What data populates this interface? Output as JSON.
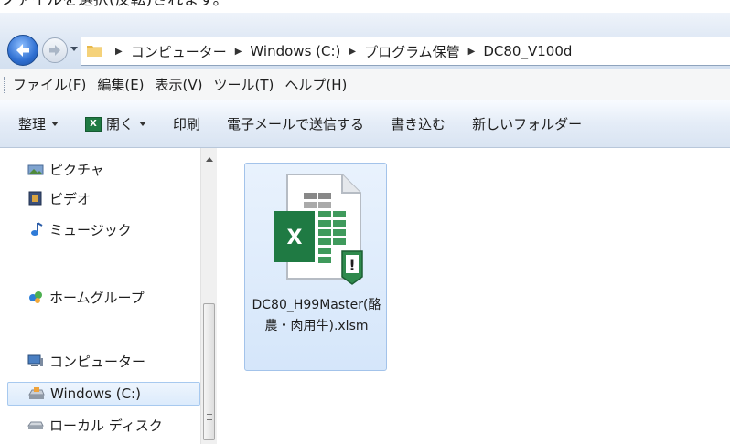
{
  "caption": "ファイルを選択(反転)されます。",
  "address": {
    "crumbs": [
      "コンピューター",
      "Windows (C:)",
      "プログラム保管",
      "DC80_V100d"
    ]
  },
  "menu": {
    "items": [
      "ファイル(F)",
      "編集(E)",
      "表示(V)",
      "ツール(T)",
      "ヘルプ(H)"
    ]
  },
  "commands": {
    "organize": "整理",
    "open": "開く",
    "print": "印刷",
    "email": "電子メールで送信する",
    "burn": "書き込む",
    "new_folder": "新しいフォルダー"
  },
  "nav": {
    "pictures": "ピクチャ",
    "videos": "ビデオ",
    "music": "ミュージック",
    "homegroup": "ホームグループ",
    "computer": "コンピューター",
    "windows_c": "Windows (C:)",
    "local_disk": "ローカル ディスク"
  },
  "file": {
    "name": "DC80_H99Master(酪農・肉用牛).xlsm",
    "icon_letter": "X",
    "badge": "!"
  },
  "colors": {
    "excel_green": "#1f7a43",
    "selection": "#d5e6fa"
  }
}
